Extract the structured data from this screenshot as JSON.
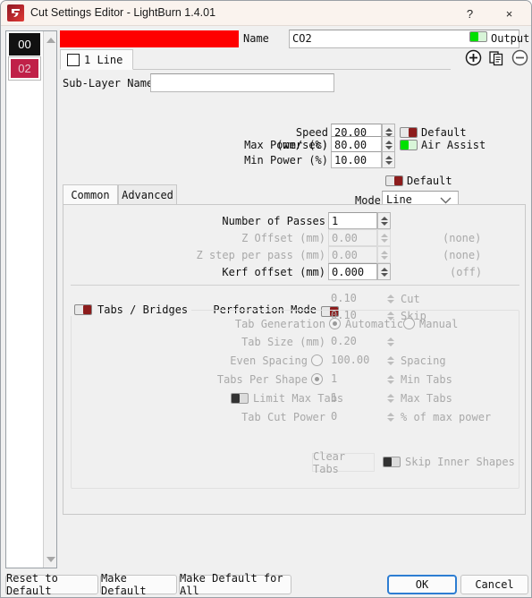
{
  "window": {
    "title": "Cut Settings Editor - LightBurn 1.4.01",
    "help_glyph": "?",
    "close_glyph": "×"
  },
  "layers": {
    "items": [
      {
        "id": "00",
        "selected": false
      },
      {
        "id": "02",
        "selected": true
      }
    ]
  },
  "header": {
    "color_swatch": "#fe0000",
    "name_label": "Name",
    "name_value": "CO2",
    "output_label": "Output",
    "output_on": true
  },
  "sublayer": {
    "tab_label": "1 Line",
    "tab_checked": false,
    "add_icon": "circle-plus-icon",
    "duplicate_icon": "copy-icon",
    "remove_icon": "circle-minus-icon",
    "name_label": "Sub-Layer Name",
    "name_value": ""
  },
  "power": {
    "speed_label": "Speed (mm/sec)",
    "speed_value": "20.00",
    "speed_default_label": "Default",
    "speed_default_on": false,
    "max_power_label": "Max Power (%)",
    "max_power_value": "80.00",
    "air_assist_label": "Air Assist",
    "air_assist_on": true,
    "min_power_label": "Min Power (%)",
    "min_power_value": "10.00",
    "power_default_label": "Default",
    "power_default_on": false,
    "mode_label": "Mode",
    "mode_value": "Line"
  },
  "tabs": {
    "common": "Common",
    "advanced": "Advanced",
    "active": "Common"
  },
  "common": {
    "passes_label": "Number of Passes",
    "passes_value": "1",
    "z_offset_label": "Z Offset (mm)",
    "z_offset_value": "0.00",
    "z_offset_aux": "(none)",
    "z_step_label": "Z step per pass (mm)",
    "z_step_value": "0.00",
    "z_step_aux": "(none)",
    "kerf_label": "Kerf offset (mm)",
    "kerf_value": "0.000",
    "kerf_aux": "(off)",
    "perforation_label": "Perforation Mode",
    "perforation_on": false,
    "cut_value": "0.10",
    "cut_label": "Cut",
    "skip_value": "0.10",
    "skip_label": "Skip"
  },
  "tabs_bridges": {
    "group_label": "Tabs / Bridges",
    "group_on": false,
    "generation_label": "Tab Generation",
    "automatic_label": "Automatic",
    "automatic_selected": true,
    "manual_label": "Manual",
    "manual_selected": false,
    "tab_size_label": "Tab Size (mm)",
    "tab_size_value": "0.20",
    "even_spacing_label": "Even Spacing",
    "even_spacing_selected": false,
    "spacing_value": "100.00",
    "spacing_aux": "Spacing",
    "tabs_per_shape_label": "Tabs Per Shape",
    "tabs_per_shape_selected": true,
    "min_tabs_value": "1",
    "min_tabs_aux": "Min Tabs",
    "limit_max_label": "Limit Max Tabs",
    "limit_max_on": false,
    "max_tabs_value": "1",
    "max_tabs_aux": "Max Tabs",
    "tab_cut_power_label": "Tab Cut Power",
    "tab_cut_power_value": "0",
    "tab_cut_power_aux": "% of max power",
    "clear_tabs_label": "Clear Tabs",
    "skip_inner_label": "Skip Inner Shapes",
    "skip_inner_on": false
  },
  "footer": {
    "reset": "Reset to Default",
    "make_default": "Make Default",
    "make_default_all": "Make Default for All",
    "ok": "OK",
    "cancel": "Cancel"
  }
}
